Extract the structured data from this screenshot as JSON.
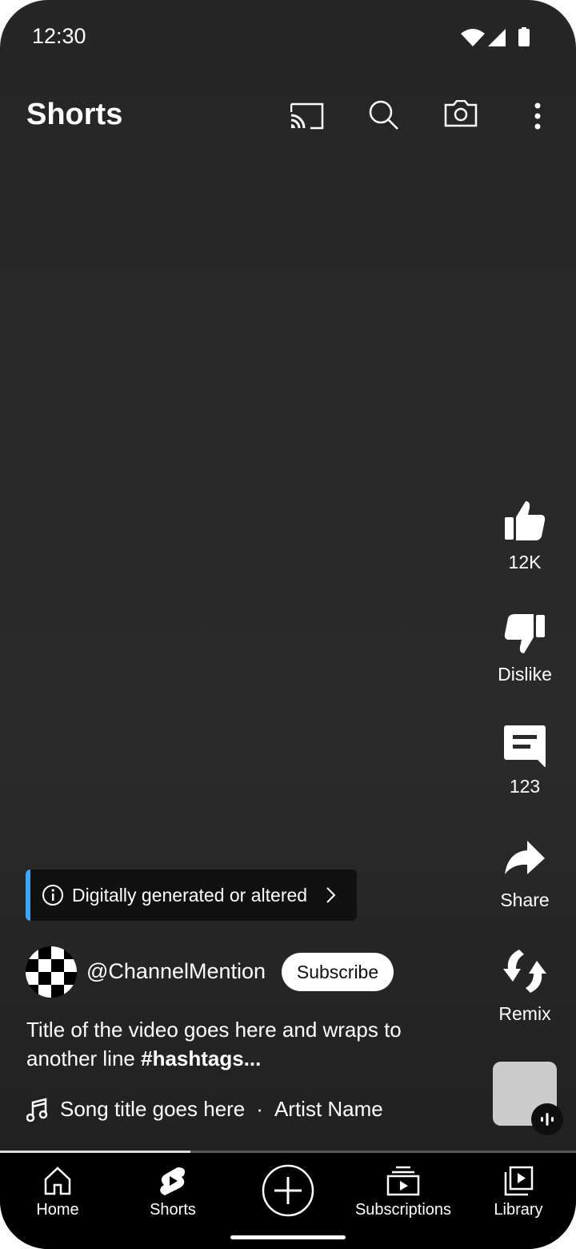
{
  "status": {
    "time": "12:30"
  },
  "header": {
    "title": "Shorts",
    "icons": [
      "cast-icon",
      "search-icon",
      "camera-icon",
      "more-vert-icon"
    ]
  },
  "actions": {
    "like": "12K",
    "dislike": "Dislike",
    "comments": "123",
    "share": "Share",
    "remix": "Remix"
  },
  "notice": {
    "text": "Digitally generated or altered",
    "accent": "#3ea6ff"
  },
  "channel": {
    "name": "@ChannelMention",
    "subscribe": "Subscribe"
  },
  "video": {
    "title": "Title of the video goes here and wraps to another line ",
    "hashtags": "#hashtags..."
  },
  "song": {
    "title": "Song title goes here",
    "separator": "·",
    "artist": "Artist Name"
  },
  "progress": {
    "percent": 33
  },
  "nav": {
    "items": [
      {
        "label": "Home"
      },
      {
        "label": "Shorts"
      },
      {
        "label": "Create"
      },
      {
        "label": "Subscriptions"
      },
      {
        "label": "Library"
      }
    ]
  }
}
